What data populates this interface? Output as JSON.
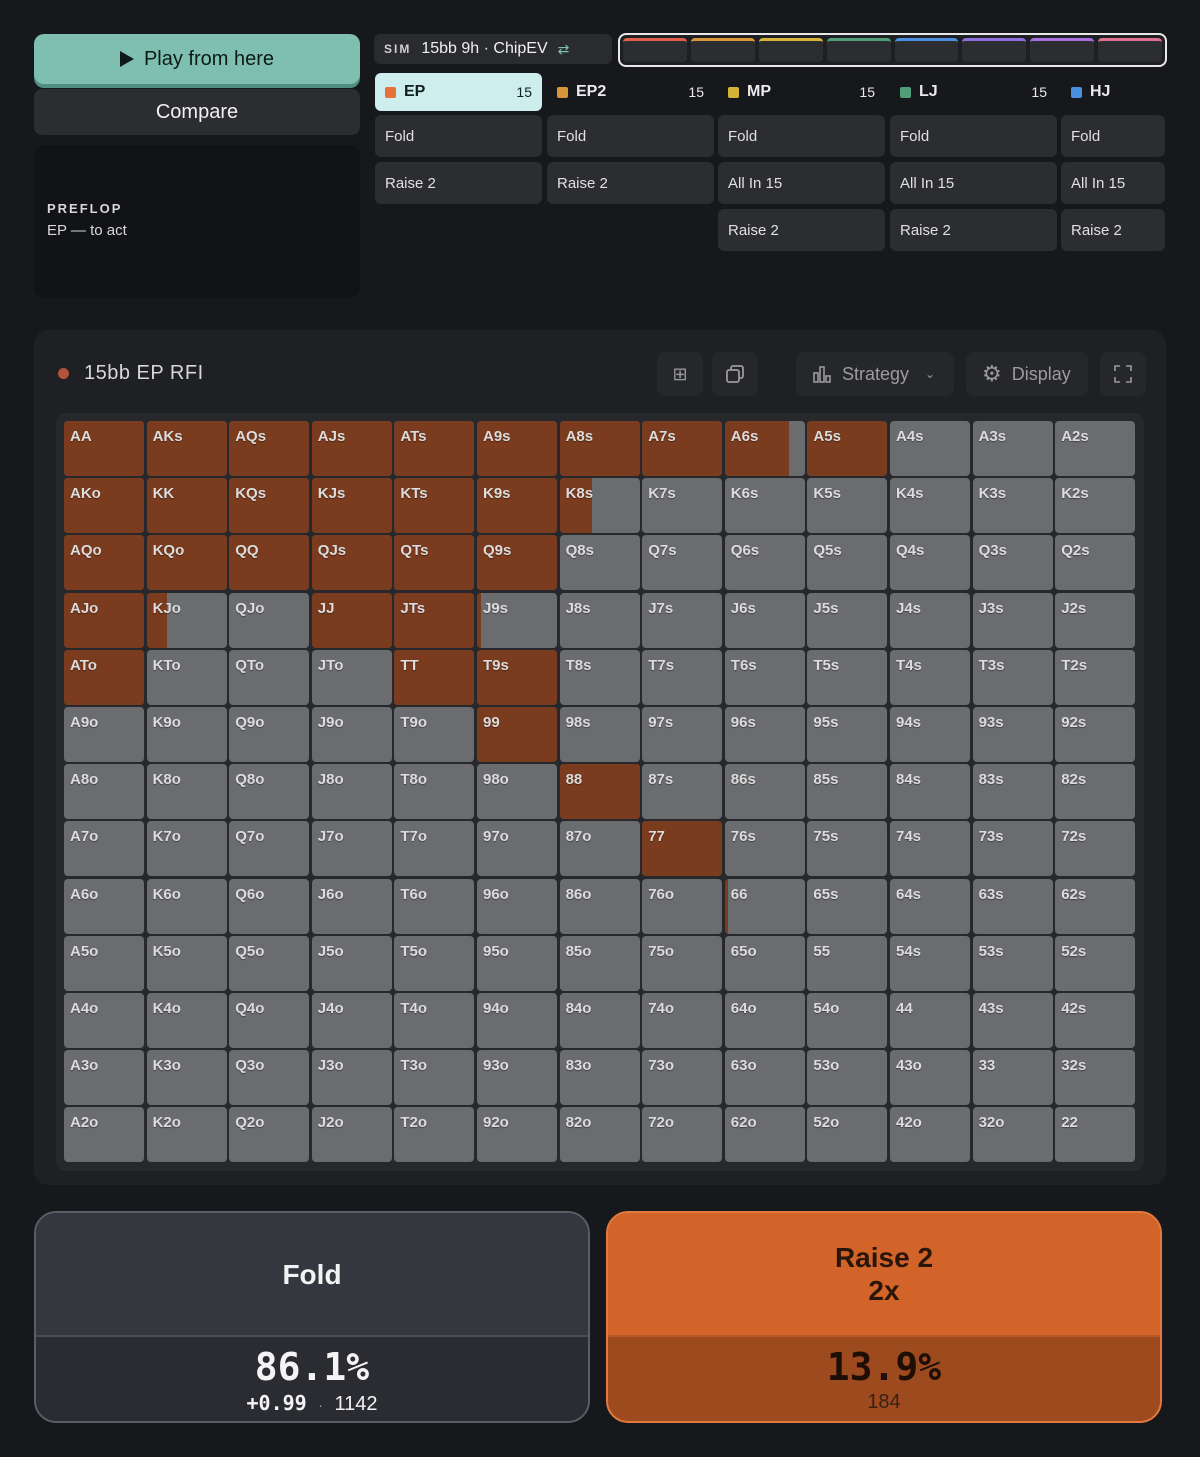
{
  "left": {
    "play_label": "Play from here",
    "compare_label": "Compare",
    "street": "PREFLOP",
    "to_act": "EP — to act"
  },
  "sim": {
    "tag": "SIM",
    "name": "15bb 9h · ChipEV"
  },
  "seat_colors": [
    "#e0604a",
    "#d9953a",
    "#d6b43a",
    "#4f9e78",
    "#4a8fe0",
    "#8f6fe0",
    "#a86fe0",
    "#e07090"
  ],
  "positions": [
    {
      "name": "EP",
      "stack": "15",
      "color": "#e8703a",
      "actions": [
        "Fold",
        "Raise 2"
      ]
    },
    {
      "name": "EP2",
      "stack": "15",
      "color": "#d9953a",
      "actions": [
        "Fold",
        "Raise 2"
      ]
    },
    {
      "name": "MP",
      "stack": "15",
      "color": "#d6b43a",
      "actions": [
        "Fold",
        "All In 15",
        "Raise 2"
      ]
    },
    {
      "name": "LJ",
      "stack": "15",
      "color": "#4f9e78",
      "actions": [
        "Fold",
        "All In 15",
        "Raise 2"
      ]
    },
    {
      "name": "HJ",
      "stack": "",
      "color": "#4a8fe0",
      "actions": [
        "Fold",
        "All In 15",
        "Raise 2"
      ]
    }
  ],
  "panel": {
    "title": "15bb EP RFI",
    "strategy_label": "Strategy",
    "display_label": "Display"
  },
  "grid": {
    "raise_color": "#7a3b1e",
    "fold_color": "#6b6c70",
    "rows": [
      [
        "AA",
        "AKs",
        "AQs",
        "AJs",
        "ATs",
        "A9s",
        "A8s",
        "A7s",
        "A6s",
        "A5s",
        "A4s",
        "A3s",
        "A2s"
      ],
      [
        "AKo",
        "KK",
        "KQs",
        "KJs",
        "KTs",
        "K9s",
        "K8s",
        "K7s",
        "K6s",
        "K5s",
        "K4s",
        "K3s",
        "K2s"
      ],
      [
        "AQo",
        "KQo",
        "QQ",
        "QJs",
        "QTs",
        "Q9s",
        "Q8s",
        "Q7s",
        "Q6s",
        "Q5s",
        "Q4s",
        "Q3s",
        "Q2s"
      ],
      [
        "AJo",
        "KJo",
        "QJo",
        "JJ",
        "JTs",
        "J9s",
        "J8s",
        "J7s",
        "J6s",
        "J5s",
        "J4s",
        "J3s",
        "J2s"
      ],
      [
        "ATo",
        "KTo",
        "QTo",
        "JTo",
        "TT",
        "T9s",
        "T8s",
        "T7s",
        "T6s",
        "T5s",
        "T4s",
        "T3s",
        "T2s"
      ],
      [
        "A9o",
        "K9o",
        "Q9o",
        "J9o",
        "T9o",
        "99",
        "98s",
        "97s",
        "96s",
        "95s",
        "94s",
        "93s",
        "92s"
      ],
      [
        "A8o",
        "K8o",
        "Q8o",
        "J8o",
        "T8o",
        "98o",
        "88",
        "87s",
        "86s",
        "85s",
        "84s",
        "83s",
        "82s"
      ],
      [
        "A7o",
        "K7o",
        "Q7o",
        "J7o",
        "T7o",
        "97o",
        "87o",
        "77",
        "76s",
        "75s",
        "74s",
        "73s",
        "72s"
      ],
      [
        "A6o",
        "K6o",
        "Q6o",
        "J6o",
        "T6o",
        "96o",
        "86o",
        "76o",
        "66",
        "65s",
        "64s",
        "63s",
        "62s"
      ],
      [
        "A5o",
        "K5o",
        "Q5o",
        "J5o",
        "T5o",
        "95o",
        "85o",
        "75o",
        "65o",
        "55",
        "54s",
        "53s",
        "52s"
      ],
      [
        "A4o",
        "K4o",
        "Q4o",
        "J4o",
        "T4o",
        "94o",
        "84o",
        "74o",
        "64o",
        "54o",
        "44",
        "43s",
        "42s"
      ],
      [
        "A3o",
        "K3o",
        "Q3o",
        "J3o",
        "T3o",
        "93o",
        "83o",
        "73o",
        "63o",
        "53o",
        "43o",
        "33",
        "32s"
      ],
      [
        "A2o",
        "K2o",
        "Q2o",
        "J2o",
        "T2o",
        "92o",
        "82o",
        "72o",
        "62o",
        "52o",
        "42o",
        "32o",
        "22"
      ]
    ],
    "raise_freq": [
      [
        1,
        1,
        1,
        1,
        1,
        1,
        1,
        1,
        0.8,
        1,
        0,
        0,
        0
      ],
      [
        1,
        1,
        1,
        1,
        1,
        1,
        0.4,
        0,
        0,
        0,
        0,
        0,
        0
      ],
      [
        1,
        1,
        1,
        1,
        1,
        1,
        0,
        0,
        0,
        0,
        0,
        0,
        0
      ],
      [
        1,
        0.25,
        0,
        1,
        1,
        0.05,
        0,
        0,
        0,
        0,
        0,
        0,
        0
      ],
      [
        1,
        0,
        0,
        0,
        1,
        1,
        0,
        0,
        0,
        0,
        0,
        0,
        0
      ],
      [
        0,
        0,
        0,
        0,
        0,
        1,
        0,
        0,
        0,
        0,
        0,
        0,
        0
      ],
      [
        0,
        0,
        0,
        0,
        0,
        0,
        1,
        0,
        0,
        0,
        0,
        0,
        0
      ],
      [
        0,
        0,
        0,
        0,
        0,
        0,
        0,
        1,
        0,
        0,
        0,
        0,
        0
      ],
      [
        0,
        0,
        0,
        0,
        0,
        0,
        0,
        0,
        0.04,
        0,
        0,
        0,
        0
      ],
      [
        0,
        0,
        0,
        0,
        0,
        0,
        0,
        0,
        0,
        0,
        0,
        0,
        0
      ],
      [
        0,
        0,
        0,
        0,
        0,
        0,
        0,
        0,
        0,
        0,
        0,
        0,
        0
      ],
      [
        0,
        0,
        0,
        0,
        0,
        0,
        0,
        0,
        0,
        0,
        0,
        0,
        0
      ],
      [
        0,
        0,
        0,
        0,
        0,
        0,
        0,
        0,
        0,
        0,
        0,
        0,
        0
      ]
    ]
  },
  "summary": {
    "fold": {
      "label": "Fold",
      "pct": "86.1%",
      "ev": "+0.99",
      "sep": "·",
      "combos": "1142"
    },
    "raise": {
      "label": "Raise 2",
      "size": "2x",
      "pct": "13.9%",
      "combos": "184"
    }
  }
}
